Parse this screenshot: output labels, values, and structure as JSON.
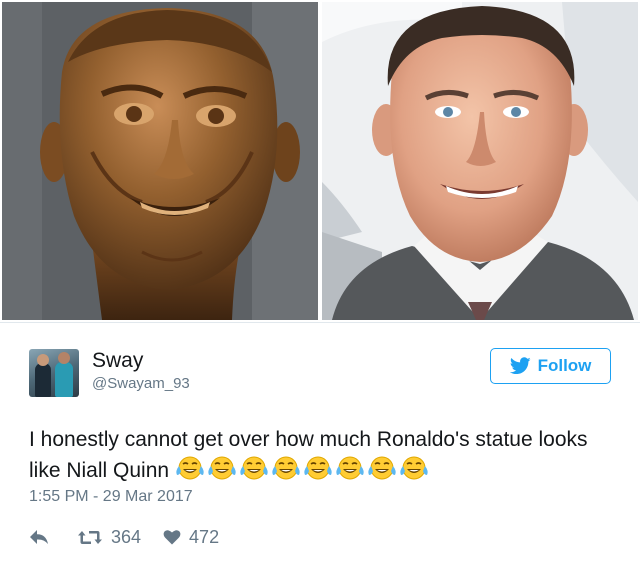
{
  "photos": {
    "left_name": "statue-bust-photo",
    "right_name": "man-in-suit-photo"
  },
  "tweet": {
    "user": {
      "name": "Sway",
      "handle": "@Swayam_93"
    },
    "follow_label": "Follow",
    "text": "I honestly cannot get over how much Ronaldo's statue looks like Niall Quinn",
    "emoji_icon": "tears-of-joy-emoji",
    "emoji_count": 8,
    "timestamp": "1:55 PM - 29 Mar 2017",
    "stats": {
      "retweets": "364",
      "likes": "472"
    },
    "colors": {
      "accent": "#1da1f2",
      "muted": "#657786",
      "text": "#14171a"
    }
  }
}
